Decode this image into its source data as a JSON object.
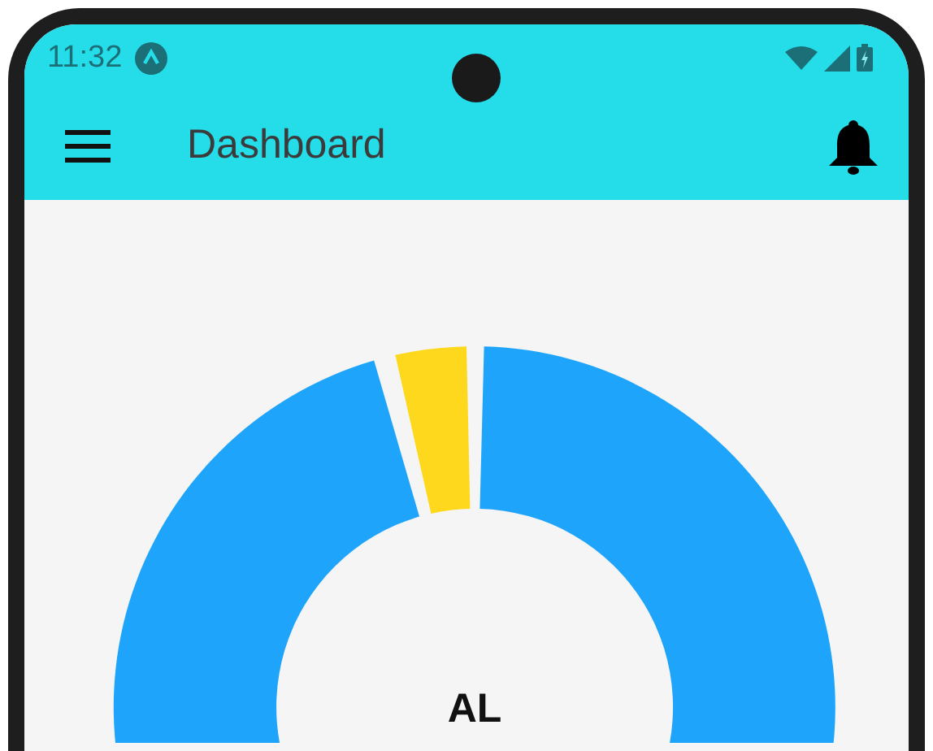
{
  "status_bar": {
    "time": "11:32"
  },
  "app_bar": {
    "title": "Dashboard"
  },
  "chart": {
    "center_label": "AL"
  }
}
